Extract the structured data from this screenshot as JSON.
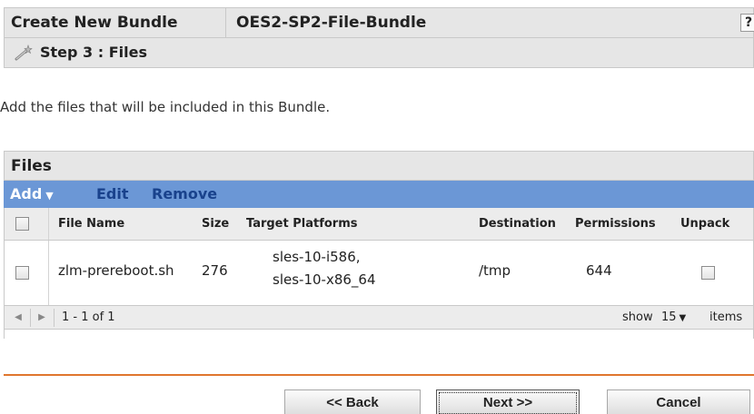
{
  "header": {
    "title_label": "Create New Bundle",
    "bundle_name": "OES2-SP2-File-Bundle",
    "help_label": "?",
    "step_label": "Step 3 : Files",
    "step_icon": "wand-icon"
  },
  "intro_text": "Add the files that will be included in this Bundle.",
  "files_panel": {
    "title": "Files",
    "toolbar": {
      "add_label": "Add",
      "edit_label": "Edit",
      "remove_label": "Remove"
    },
    "columns": [
      "File Name",
      "Size",
      "Target Platforms",
      "Destination",
      "Permissions",
      "Unpack"
    ],
    "rows": [
      {
        "file_name": "zlm-prereboot.sh",
        "size": "276",
        "platform_1": "sles-10-i586,",
        "platform_2": "sles-10-x86_64",
        "destination": "/tmp",
        "permissions": "644",
        "unpack": false,
        "selected": false
      }
    ],
    "pager": {
      "range_text": "1 - 1 of 1",
      "show_label": "show",
      "page_size": "15",
      "items_label": "items"
    }
  },
  "buttons": {
    "back": "<< Back",
    "next": "Next >>",
    "cancel": "Cancel"
  },
  "colors": {
    "toolbar_bg": "#6b97d6",
    "header_bg": "#e6e6e6",
    "divider": "#e0762e",
    "link": "#19428c"
  }
}
